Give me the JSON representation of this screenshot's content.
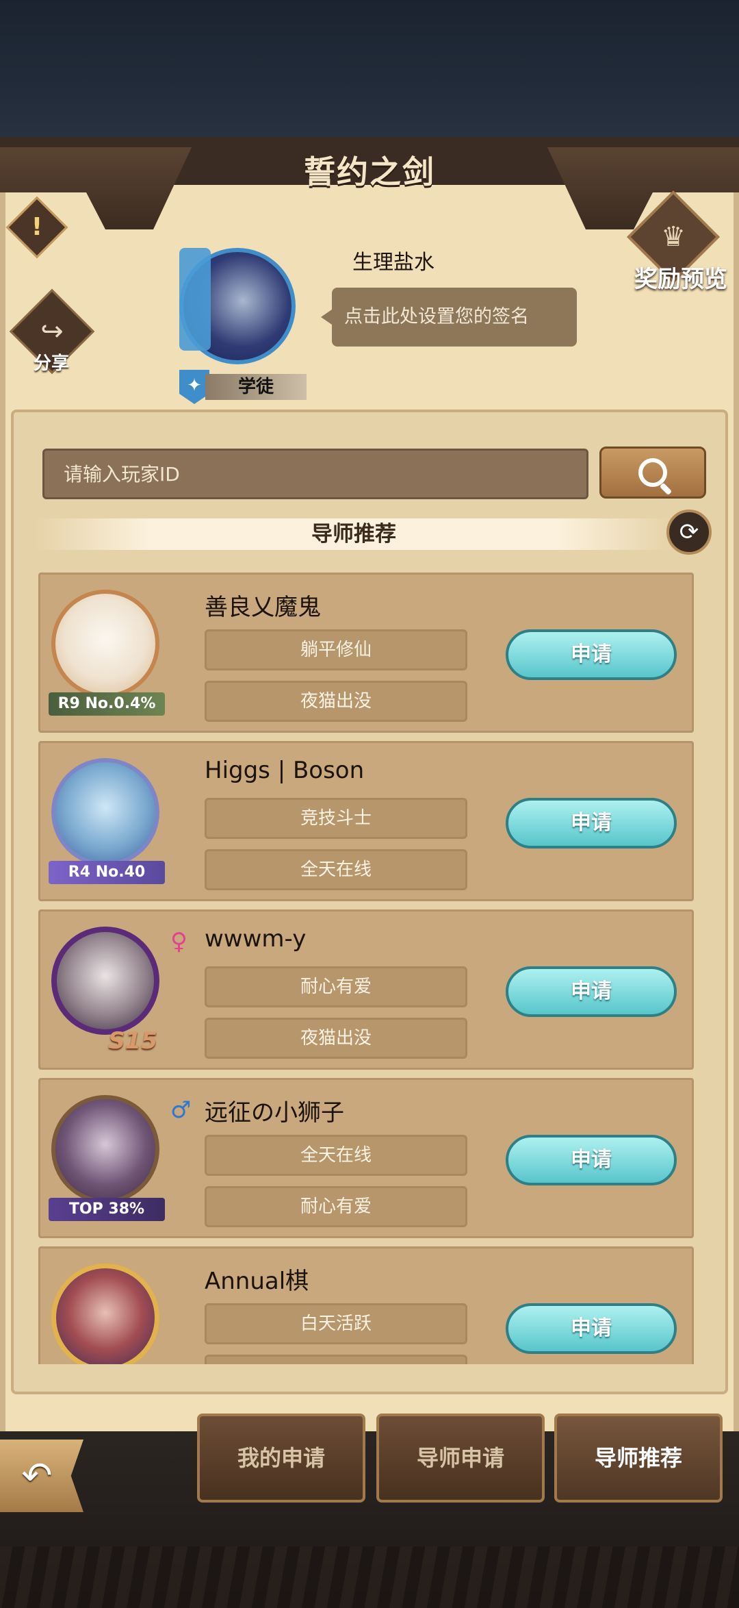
{
  "page": {
    "title": "誓约之剑"
  },
  "left_buttons": {
    "warning_icon": "!",
    "share_label": "分享"
  },
  "right_buttons": {
    "reward_label": "奖励预览"
  },
  "profile": {
    "username": "生理盐水",
    "signature_placeholder": "点击此处设置您的签名",
    "rank_label": "学徒"
  },
  "search": {
    "placeholder": "请输入玩家ID"
  },
  "section": {
    "title": "导师推荐"
  },
  "mentors": [
    {
      "name": "善良乂魔鬼",
      "badge": "R9 No.0.4%",
      "tags": [
        "躺平修仙",
        "夜猫出没"
      ],
      "gender": "",
      "apply": "申请"
    },
    {
      "name": "Higgs | Boson",
      "badge": "R4 No.40",
      "tags": [
        "竞技斗士",
        "全天在线"
      ],
      "gender": "",
      "apply": "申请"
    },
    {
      "name": "wwwm-y",
      "badge": "S15",
      "tags": [
        "耐心有爱",
        "夜猫出没"
      ],
      "gender": "♀",
      "apply": "申请"
    },
    {
      "name": "远征の小狮子",
      "badge": "TOP 38%",
      "tags": [
        "全天在线",
        "耐心有爱"
      ],
      "gender": "♂",
      "apply": "申请"
    },
    {
      "name": "Annual棋",
      "badge": "",
      "tags": [
        "白天活跃",
        ""
      ],
      "gender": "",
      "apply": "申请"
    }
  ],
  "bottom_tabs": {
    "my_applications": "我的申请",
    "mentor_applications": "导师申请",
    "mentor_recommend": "导师推荐"
  },
  "colors": {
    "accent_apply": "#58c6cb",
    "panel_bg": "#f1dfb8",
    "card_bg": "#c8a87c"
  }
}
